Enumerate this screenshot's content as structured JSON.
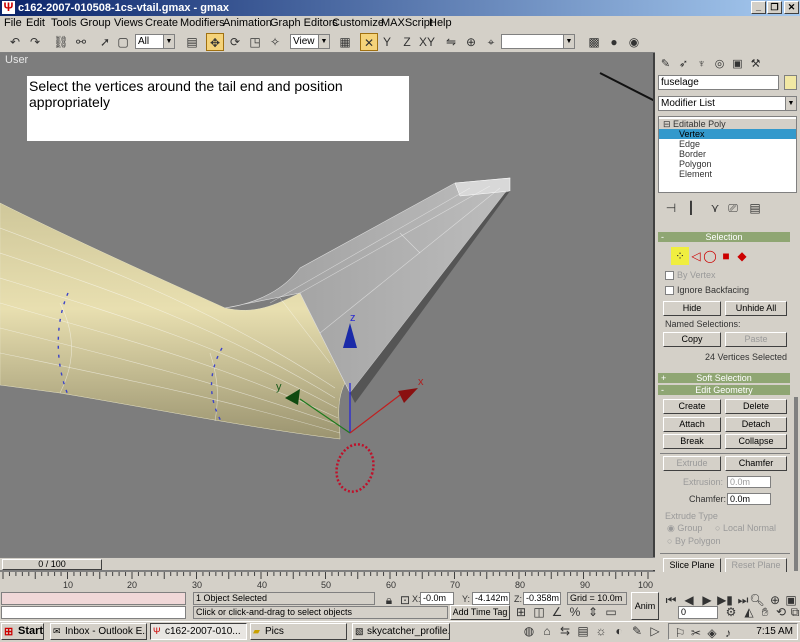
{
  "window": {
    "title": "c162-2007-010508-1cs-vtail.gmax - gmax",
    "controls": [
      "minimize",
      "restore",
      "close"
    ]
  },
  "menu": [
    "File",
    "Edit",
    "Tools",
    "Group",
    "Views",
    "Create",
    "Modifiers",
    "Animation",
    "Graph Editors",
    "Customize",
    "MAXScript",
    "Help"
  ],
  "toolbar": {
    "selection_filter": "All",
    "reference_coord": "View",
    "named_selection": ""
  },
  "viewport": {
    "label": "User",
    "instruction": "Select the vertices around the tail end and position appropriately",
    "gizmo": {
      "x_label": "x",
      "y_label": "y",
      "z_label": "z"
    }
  },
  "command_panel": {
    "object_name": "fuselage",
    "object_color": "#f2e8a4",
    "modifier_list": "Modifier List",
    "stack": {
      "root": "Editable Poly",
      "items": [
        "Vertex",
        "Edge",
        "Border",
        "Polygon",
        "Element"
      ],
      "selected": "Vertex"
    },
    "selection_rollout": {
      "title": "Selection",
      "by_vertex": "By Vertex",
      "ignore_backfacing": "Ignore Backfacing",
      "hide": "Hide",
      "unhide_all": "Unhide All",
      "named_selections": "Named Selections:",
      "copy": "Copy",
      "paste": "Paste",
      "status": "24 Vertices Selected"
    },
    "soft_selection": {
      "title": "Soft Selection",
      "sign": "+"
    },
    "edit_geometry": {
      "title": "Edit Geometry",
      "sign": "-",
      "create": "Create",
      "delete": "Delete",
      "attach": "Attach",
      "detach": "Detach",
      "break": "Break",
      "collapse": "Collapse",
      "extrude": "Extrude",
      "chamfer": "Chamfer",
      "extrusion_label": "Extrusion:",
      "extrusion_value": "0.0m",
      "chamfer_label": "Chamfer:",
      "chamfer_value": "0.0m",
      "extrude_type": "Extrude Type",
      "group": "Group",
      "local_normal": "Local Normal",
      "by_polygon": "By Polygon",
      "slice_plane": "Slice Plane",
      "reset_plane": "Reset Plane"
    }
  },
  "timeline": {
    "frame": "0 / 100",
    "ticks": [
      "10",
      "20",
      "30",
      "40",
      "50",
      "60",
      "70",
      "80",
      "90",
      "100"
    ]
  },
  "status": {
    "object_selected": "1 Object Selected",
    "prompt": "Click or click-and-drag to select objects",
    "x_label": "X:",
    "x": "-0.0m",
    "y_label": "Y:",
    "y": "-4.142m",
    "z_label": "Z:",
    "z": "-0.358m",
    "grid": "Grid = 10.0m",
    "add_time_tag": "Add Time Tag",
    "anim": "Anim",
    "frame_field": "0"
  },
  "taskbar": {
    "start": "Start",
    "tasks": [
      "Inbox - Outlook E...",
      "c162-2007-010...",
      "Pics",
      "skycatcher_profile..."
    ],
    "active_task": "c162-2007-010...",
    "clock": "7:15 AM"
  }
}
